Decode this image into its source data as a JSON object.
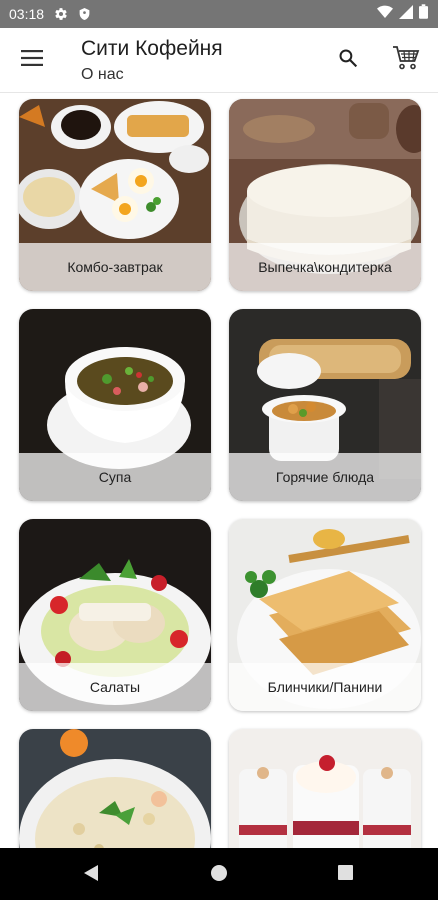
{
  "status_bar": {
    "time": "03:18",
    "left_icons": [
      "settings-gear-icon",
      "shield-icon"
    ],
    "right_icons": [
      "wifi-icon",
      "signal-icon",
      "battery-icon"
    ]
  },
  "app_bar": {
    "title": "Сити Кофейня",
    "subtitle": "О нас",
    "menu_icon": "hamburger-menu-icon",
    "search_icon": "search-icon",
    "cart_icon": "shopping-cart-icon"
  },
  "categories": [
    {
      "label": "Комбо-завтрак",
      "image": "breakfast-combo-photo"
    },
    {
      "label": "Выпечка\\кондитерка",
      "image": "cheesecake-pastry-photo"
    },
    {
      "label": "Супа",
      "image": "soup-bowl-photo"
    },
    {
      "label": "Горячие блюда",
      "image": "hot-dish-pot-photo"
    },
    {
      "label": "Салаты",
      "image": "caesar-salad-photo"
    },
    {
      "label": "Блинчики/Панини",
      "image": "crepes-honey-photo"
    },
    {
      "label": "",
      "image": "porridge-bowl-photo"
    },
    {
      "label": "",
      "image": "dessert-glasses-photo"
    }
  ],
  "nav_bar": {
    "back_icon": "back-triangle-icon",
    "home_icon": "home-circle-icon",
    "recents_icon": "recents-square-icon"
  },
  "colors": {
    "status_bar": "#757575",
    "app_bar": "#ffffff",
    "nav_bar": "#000000",
    "label_overlay": "rgba(255,255,255,0.72)"
  }
}
